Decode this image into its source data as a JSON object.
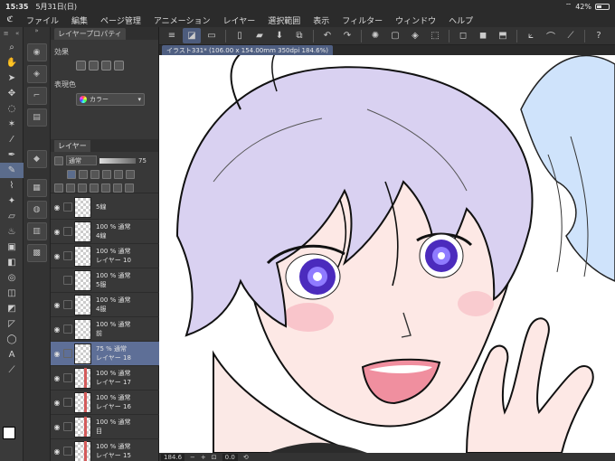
{
  "status": {
    "time": "15:35",
    "date": "5月31日(日)",
    "battery": "42%",
    "battery_level": 0.42
  },
  "menu": [
    "ファイル",
    "編集",
    "ページ管理",
    "アニメーション",
    "レイヤー",
    "選択範囲",
    "表示",
    "フィルター",
    "ウィンドウ",
    "ヘルプ"
  ],
  "property_panel": {
    "title": "レイヤープロパティ",
    "effect_label": "効果",
    "expression_color_label": "表現色",
    "expression_color_value": "カラー"
  },
  "layer_panel": {
    "title": "レイヤー",
    "blend_mode": "通常",
    "opacity": "75"
  },
  "layers": [
    {
      "line1": "5線",
      "line2": "",
      "visible": true,
      "selected": false,
      "red": false
    },
    {
      "line1": "100 % 通常",
      "line2": "4線",
      "visible": true,
      "selected": false,
      "red": false
    },
    {
      "line1": "100 % 通常",
      "line2": "レイヤー 10",
      "visible": true,
      "selected": false,
      "red": false
    },
    {
      "line1": "100 % 通常",
      "line2": "5服",
      "visible": false,
      "selected": false,
      "red": false
    },
    {
      "line1": "100 % 通常",
      "line2": "4服",
      "visible": true,
      "selected": false,
      "red": false
    },
    {
      "line1": "100 % 通常",
      "line2": "前",
      "visible": true,
      "selected": false,
      "red": false
    },
    {
      "line1": "75 % 通常",
      "line2": "レイヤー 18",
      "visible": true,
      "selected": true,
      "red": false
    },
    {
      "line1": "100 % 通常",
      "line2": "レイヤー 17",
      "visible": true,
      "selected": false,
      "red": true
    },
    {
      "line1": "100 % 通常",
      "line2": "レイヤー 16",
      "visible": true,
      "selected": false,
      "red": true
    },
    {
      "line1": "100 % 通常",
      "line2": "目",
      "visible": true,
      "selected": false,
      "red": true
    },
    {
      "line1": "100 % 通常",
      "line2": "レイヤー 15",
      "visible": true,
      "selected": false,
      "red": true
    }
  ],
  "document": {
    "tab_title": "イラスト331* (106.00 x 154.00mm 350dpi 184.6%)"
  },
  "bottom": {
    "zoom": "184.6",
    "angle": "0.0"
  }
}
